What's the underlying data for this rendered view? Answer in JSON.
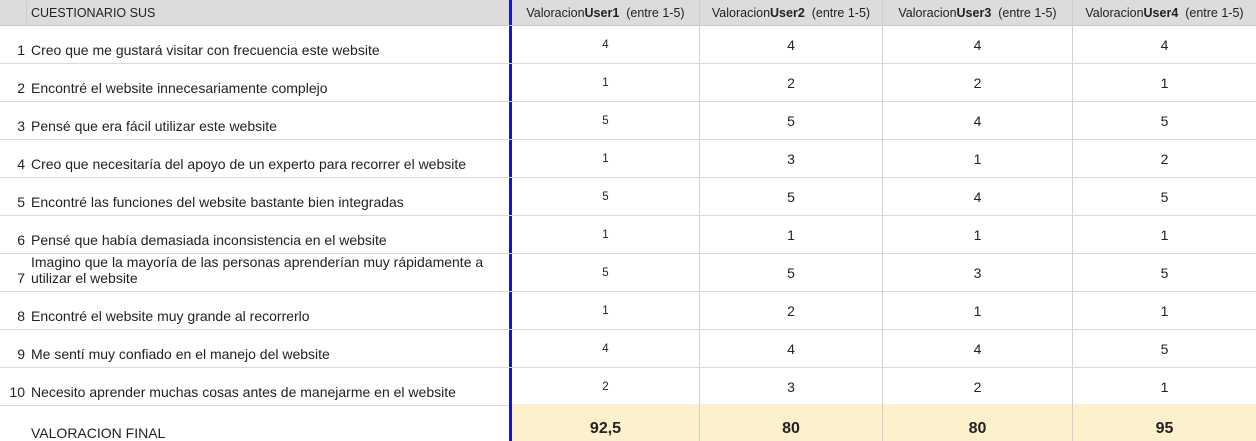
{
  "header": {
    "title": "CUESTIONARIO SUS",
    "users": [
      {
        "prefix": "Valoracion ",
        "user": "User1",
        "suffix": "  (entre 1-5)"
      },
      {
        "prefix": "Valoracion ",
        "user": "User2",
        "suffix": "  (entre 1-5)"
      },
      {
        "prefix": "Valoracion ",
        "user": "User3",
        "suffix": "  (entre 1-5)"
      },
      {
        "prefix": "Valoracion ",
        "user": "User4",
        "suffix": "  (entre 1-5)"
      }
    ]
  },
  "rows": [
    {
      "num": "1",
      "question": "Creo que me gustará visitar con frecuencia este website",
      "values": [
        "4",
        "4",
        "4",
        "4"
      ]
    },
    {
      "num": "2",
      "question": "Encontré el website innecesariamente complejo",
      "values": [
        "1",
        "2",
        "2",
        "1"
      ]
    },
    {
      "num": "3",
      "question": "Pensé que era fácil utilizar este website",
      "values": [
        "5",
        "5",
        "4",
        "5"
      ]
    },
    {
      "num": "4",
      "question": "Creo que necesitaría del apoyo de un experto para recorrer el website",
      "values": [
        "1",
        "3",
        "1",
        "2"
      ]
    },
    {
      "num": "5",
      "question": "Encontré las funciones del website bastante bien integradas",
      "values": [
        "5",
        "5",
        "4",
        "5"
      ]
    },
    {
      "num": "6",
      "question": "Pensé que había demasiada inconsistencia en el website",
      "values": [
        "1",
        "1",
        "1",
        "1"
      ]
    },
    {
      "num": "7",
      "question": "Imagino que la mayoría de las personas aprenderían muy rápidamente a utilizar el website",
      "values": [
        "5",
        "5",
        "3",
        "5"
      ]
    },
    {
      "num": "8",
      "question": "Encontré el website muy grande al recorrerlo",
      "values": [
        "1",
        "2",
        "1",
        "1"
      ]
    },
    {
      "num": "9",
      "question": "Me sentí muy confiado en el manejo del website",
      "values": [
        "4",
        "4",
        "4",
        "5"
      ]
    },
    {
      "num": "10",
      "question": "Necesito aprender muchas cosas antes de manejarme en el website",
      "values": [
        "2",
        "3",
        "2",
        "1"
      ]
    }
  ],
  "final": {
    "label": "VALORACION FINAL",
    "scores": [
      "92,5",
      "80",
      "80",
      "95"
    ]
  },
  "colors": {
    "divider": "#1515c9",
    "final_bg": "#fdf0cc",
    "header_bg": "#dcdcdc"
  }
}
